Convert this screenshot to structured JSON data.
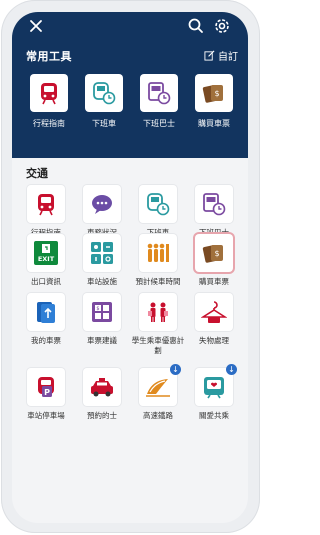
{
  "topbar": {
    "close_icon": "close-icon",
    "search_icon": "search-icon",
    "settings_icon": "gear-icon"
  },
  "favorites": {
    "title": "常用工具",
    "edit_label": "自訂",
    "items": [
      {
        "label": "行程指南",
        "icon": "train-icon"
      },
      {
        "label": "下班車",
        "icon": "next-train-icon"
      },
      {
        "label": "下班巴士",
        "icon": "next-bus-icon"
      },
      {
        "label": "購買車票",
        "icon": "ticket-purchase-icon"
      }
    ]
  },
  "transport": {
    "title": "交通",
    "items": [
      {
        "label": "行程指南",
        "icon": "train-icon"
      },
      {
        "label": "車務狀況",
        "icon": "speech-bubble-icon"
      },
      {
        "label": "下班車",
        "icon": "next-train-icon"
      },
      {
        "label": "下班巴士",
        "icon": "next-bus-icon"
      },
      {
        "label": "出口資訊",
        "icon": "exit-sign-icon",
        "tile_text": "EXIT"
      },
      {
        "label": "車站設施",
        "icon": "facilities-icon"
      },
      {
        "label": "預計候車時間",
        "icon": "waiting-people-icon"
      },
      {
        "label": "購買車票",
        "icon": "ticket-purchase-icon"
      },
      {
        "label": "我的車票",
        "icon": "my-ticket-icon"
      },
      {
        "label": "車票建議",
        "icon": "fare-calculator-icon"
      },
      {
        "label": "學生乘車優惠計劃",
        "icon": "student-icon"
      },
      {
        "label": "失物處理",
        "icon": "lost-property-icon"
      },
      {
        "label": "車站停車場",
        "icon": "car-park-icon"
      },
      {
        "label": "預約的士",
        "icon": "taxi-icon"
      },
      {
        "label": "高速鐵路",
        "icon": "high-speed-rail-icon"
      },
      {
        "label": "關愛共乘",
        "icon": "caring-ride-icon"
      }
    ]
  },
  "colors": {
    "header": "#12345f",
    "mtr_red": "#c8102e",
    "purple": "#7b4aa0",
    "teal": "#2a9aa0",
    "brown": "#7a4a22"
  }
}
